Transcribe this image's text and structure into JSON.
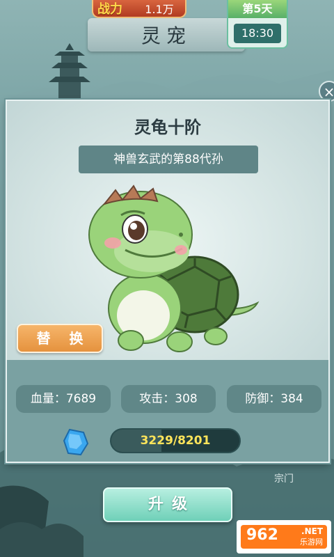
{
  "header": {
    "power_label": "战力",
    "power_value": "1.1万",
    "title": "灵宠",
    "day_label": "第5天",
    "time": "18:30"
  },
  "close_label": "×",
  "pet": {
    "name": "灵龟十阶",
    "description": "神兽玄武的第88代孙",
    "swap_label": "替 换"
  },
  "stats": {
    "hp": "血量：7689",
    "attack": "攻击：308",
    "defense": "防御：384"
  },
  "experience": {
    "text": "3229/8201",
    "current": 3229,
    "max": 8201
  },
  "section_label": "宗门",
  "upgrade_label": "升级",
  "watermark": {
    "logo_text": "962",
    "logo_suffix": ".NET",
    "logo_sub": "乐游网"
  },
  "icons": [
    "close-icon",
    "gem-icon",
    "turtle-pet-image",
    "pagoda-decoration"
  ],
  "colors": {
    "swap_button": "#e99a47",
    "upgrade_button": "#8fe0ca",
    "exp_text": "#ffe45a"
  }
}
